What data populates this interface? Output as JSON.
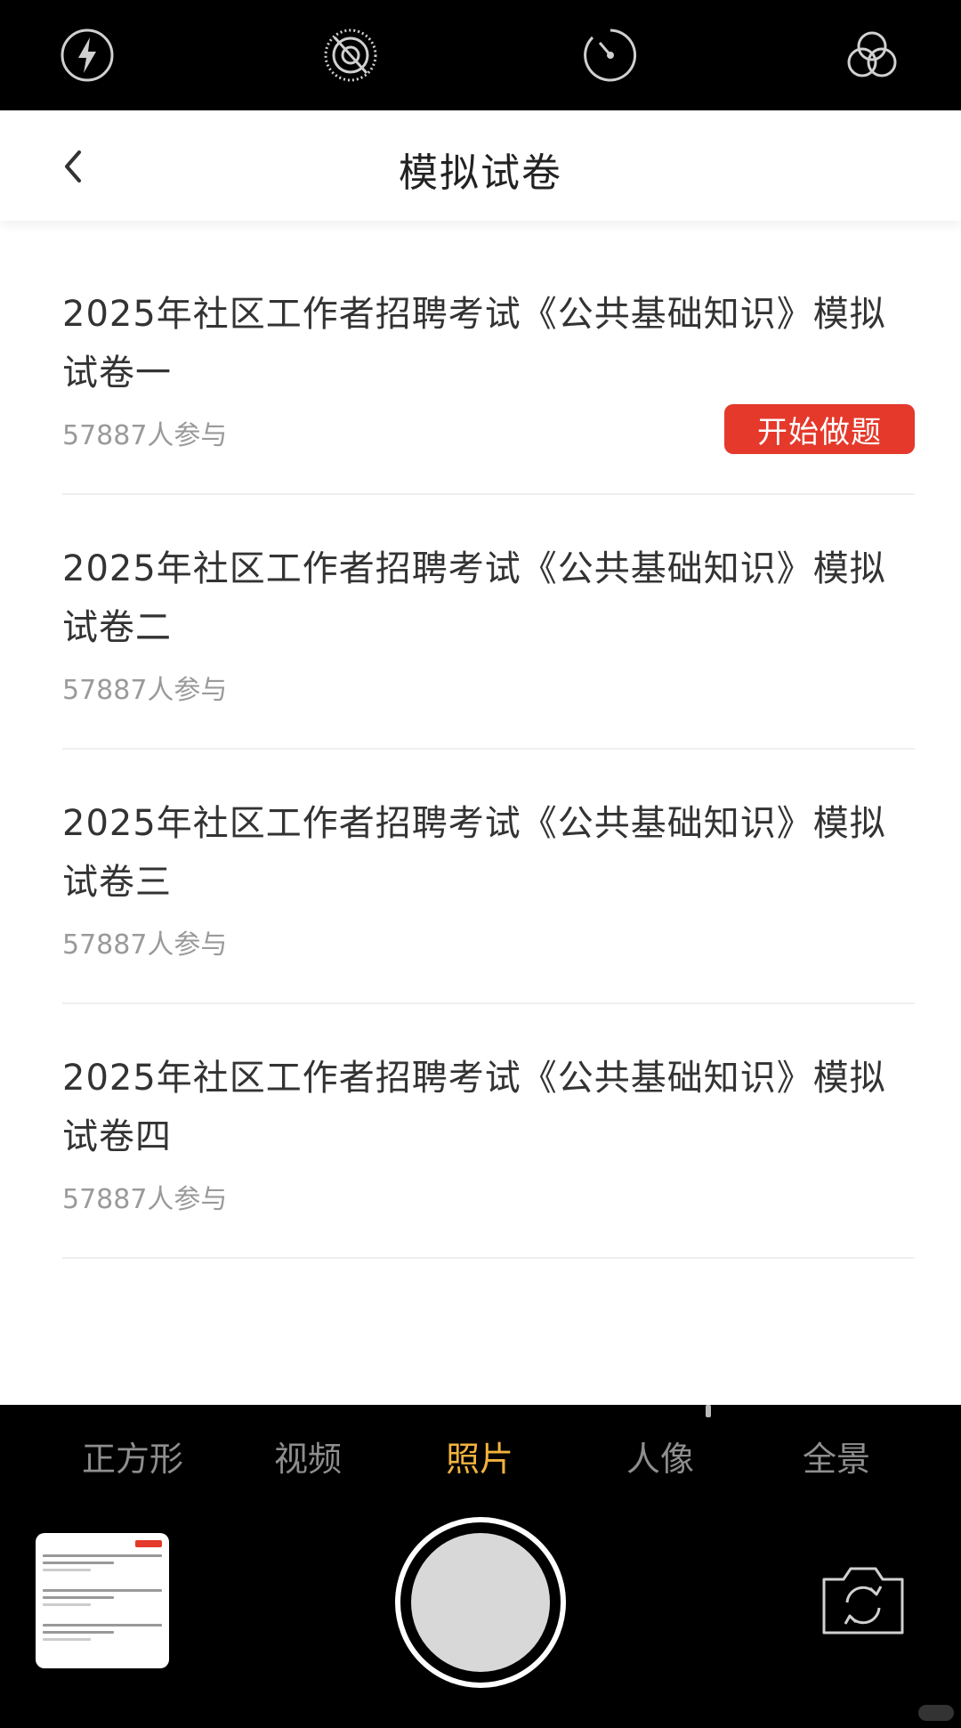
{
  "camera": {
    "top_tools": [
      {
        "name": "flash-icon"
      },
      {
        "name": "live-photo-off-icon"
      },
      {
        "name": "timer-icon"
      },
      {
        "name": "filters-icon"
      }
    ],
    "modes": [
      "正方形",
      "视频",
      "照片",
      "人像",
      "全景"
    ],
    "active_mode": "照片",
    "shutter_icon": "shutter-button",
    "switch_camera_icon": "camera-flip-icon"
  },
  "app": {
    "header": {
      "title": "模拟试卷",
      "back_icon": "chevron-left-icon"
    },
    "exams": [
      {
        "title": "2025年社区工作者招聘考试《公共基础知识》模拟试卷一",
        "participants": "57887人参与",
        "button": "开始做题"
      },
      {
        "title": "2025年社区工作者招聘考试《公共基础知识》模拟试卷二",
        "participants": "57887人参与"
      },
      {
        "title": "2025年社区工作者招聘考试《公共基础知识》模拟试卷三",
        "participants": "57887人参与"
      },
      {
        "title": "2025年社区工作者招聘考试《公共基础知识》模拟试卷四",
        "participants": "57887人参与"
      }
    ]
  },
  "colors": {
    "accent_red": "#e4392b",
    "active_mode": "#f2b33d",
    "text_primary": "#333333",
    "text_secondary": "#9a9a9a"
  }
}
